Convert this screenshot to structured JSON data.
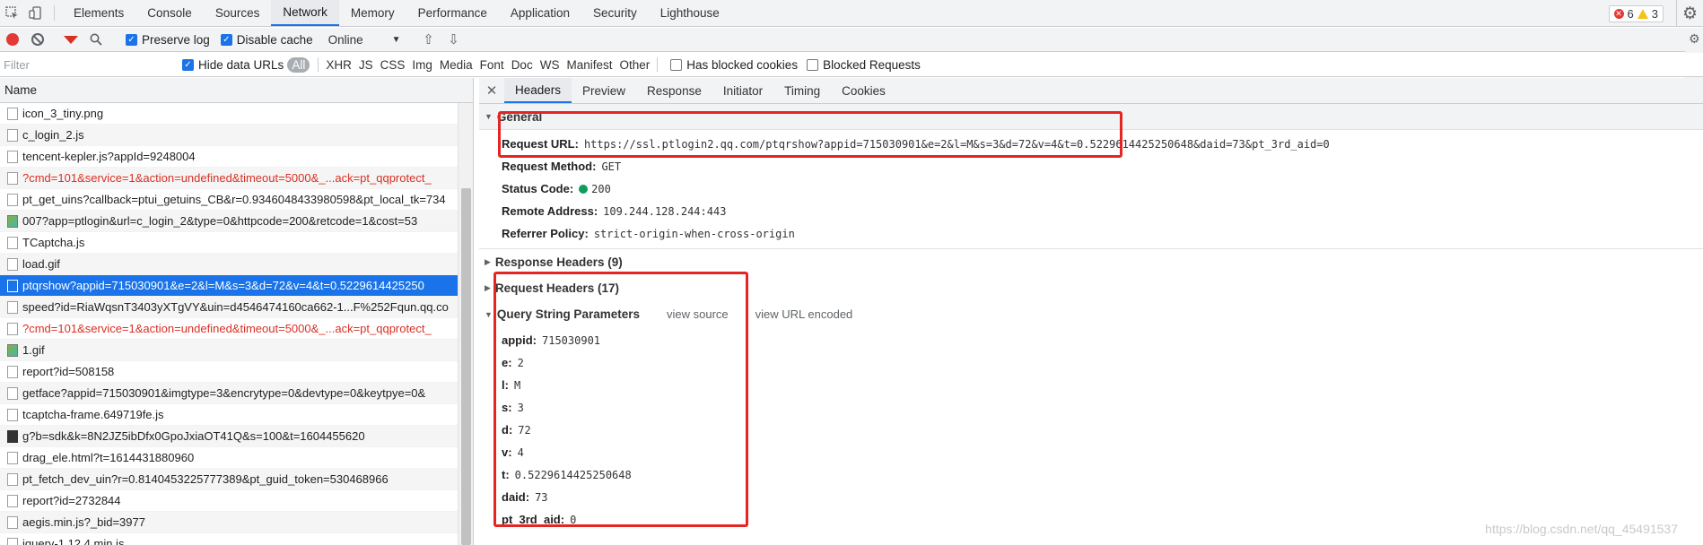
{
  "top_tabs": [
    "Elements",
    "Console",
    "Sources",
    "Network",
    "Memory",
    "Performance",
    "Application",
    "Security",
    "Lighthouse"
  ],
  "active_tab": "Network",
  "error_count": "6",
  "warning_count": "3",
  "toolbar": {
    "preserve_log": "Preserve log",
    "disable_cache": "Disable cache",
    "throttle": "Online"
  },
  "filter": {
    "placeholder": "Filter",
    "hide_data_urls": "Hide data URLs",
    "types": [
      "All",
      "XHR",
      "JS",
      "CSS",
      "Img",
      "Media",
      "Font",
      "Doc",
      "WS",
      "Manifest",
      "Other"
    ],
    "has_blocked_cookies": "Has blocked cookies",
    "blocked_requests": "Blocked Requests"
  },
  "list": {
    "header": "Name",
    "rows": [
      {
        "name": "icon_3_tiny.png",
        "red": false,
        "icon": "file"
      },
      {
        "name": "c_login_2.js",
        "red": false,
        "icon": "file"
      },
      {
        "name": "tencent-kepler.js?appId=9248004",
        "red": false,
        "icon": "file"
      },
      {
        "name": "?cmd=101&service=1&action=undefined&timeout=5000&_...ack=pt_qqprotect_",
        "red": true,
        "icon": "file"
      },
      {
        "name": "pt_get_uins?callback=ptui_getuins_CB&r=0.9346048433980598&pt_local_tk=734",
        "red": false,
        "icon": "file"
      },
      {
        "name": "007?app=ptlogin&url=c_login_2&type=0&httpcode=200&retcode=1&cost=53",
        "red": false,
        "icon": "img"
      },
      {
        "name": "TCaptcha.js",
        "red": false,
        "icon": "file"
      },
      {
        "name": "load.gif",
        "red": false,
        "icon": "file"
      },
      {
        "name": "ptqrshow?appid=715030901&e=2&l=M&s=3&d=72&v=4&t=0.5229614425250",
        "red": false,
        "icon": "file",
        "selected": true
      },
      {
        "name": "speed?id=RiaWqsnT3403yXTgVY&uin=d4546474160ca662-1...F%252Fqun.qq.co",
        "red": false,
        "icon": "file"
      },
      {
        "name": "?cmd=101&service=1&action=undefined&timeout=5000&_...ack=pt_qqprotect_",
        "red": true,
        "icon": "file"
      },
      {
        "name": "1.gif",
        "red": false,
        "icon": "img"
      },
      {
        "name": "report?id=508158",
        "red": false,
        "icon": "file"
      },
      {
        "name": "getface?appid=715030901&imgtype=3&encrytype=0&devtype=0&keytpye=0&",
        "red": false,
        "icon": "file"
      },
      {
        "name": "tcaptcha-frame.649719fe.js",
        "red": false,
        "icon": "file"
      },
      {
        "name": "g?b=sdk&k=8N2JZ5ibDfx0GpoJxiaOT41Q&s=100&t=1604455620",
        "red": false,
        "icon": "dark"
      },
      {
        "name": "drag_ele.html?t=1614431880960",
        "red": false,
        "icon": "file"
      },
      {
        "name": "pt_fetch_dev_uin?r=0.8140453225777389&pt_guid_token=530468966",
        "red": false,
        "icon": "file"
      },
      {
        "name": "report?id=2732844",
        "red": false,
        "icon": "file"
      },
      {
        "name": "aegis.min.js?_bid=3977",
        "red": false,
        "icon": "file"
      },
      {
        "name": "jquery-1.12.4.min.js",
        "red": false,
        "icon": "file"
      }
    ]
  },
  "detail": {
    "tabs": [
      "Headers",
      "Preview",
      "Response",
      "Initiator",
      "Timing",
      "Cookies"
    ],
    "active_tab": "Headers",
    "general_title": "General",
    "general": [
      {
        "k": "Request URL:",
        "v": "https://ssl.ptlogin2.qq.com/ptqrshow?appid=715030901&e=2&l=M&s=3&d=72&v=4&t=0.5229614425250648&daid=73&pt_3rd_aid=0"
      },
      {
        "k": "Request Method:",
        "v": "GET"
      },
      {
        "k": "Status Code:",
        "v": "200"
      },
      {
        "k": "Remote Address:",
        "v": "109.244.128.244:443"
      },
      {
        "k": "Referrer Policy:",
        "v": "strict-origin-when-cross-origin"
      }
    ],
    "response_headers": "Response Headers (9)",
    "request_headers": "Request Headers (17)",
    "qsp_title": "Query String Parameters",
    "view_source": "view source",
    "view_url_encoded": "view URL encoded",
    "params": [
      {
        "k": "appid:",
        "v": "715030901"
      },
      {
        "k": "e:",
        "v": "2"
      },
      {
        "k": "l:",
        "v": "M"
      },
      {
        "k": "s:",
        "v": "3"
      },
      {
        "k": "d:",
        "v": "72"
      },
      {
        "k": "v:",
        "v": "4"
      },
      {
        "k": "t:",
        "v": "0.5229614425250648"
      },
      {
        "k": "daid:",
        "v": "73"
      },
      {
        "k": "pt_3rd_aid:",
        "v": "0"
      }
    ]
  },
  "watermark": "https://blog.csdn.net/qq_45491537",
  "colors": {
    "accent": "#1a73e8",
    "highlight_box": "#e52424",
    "error": "#d93025"
  }
}
